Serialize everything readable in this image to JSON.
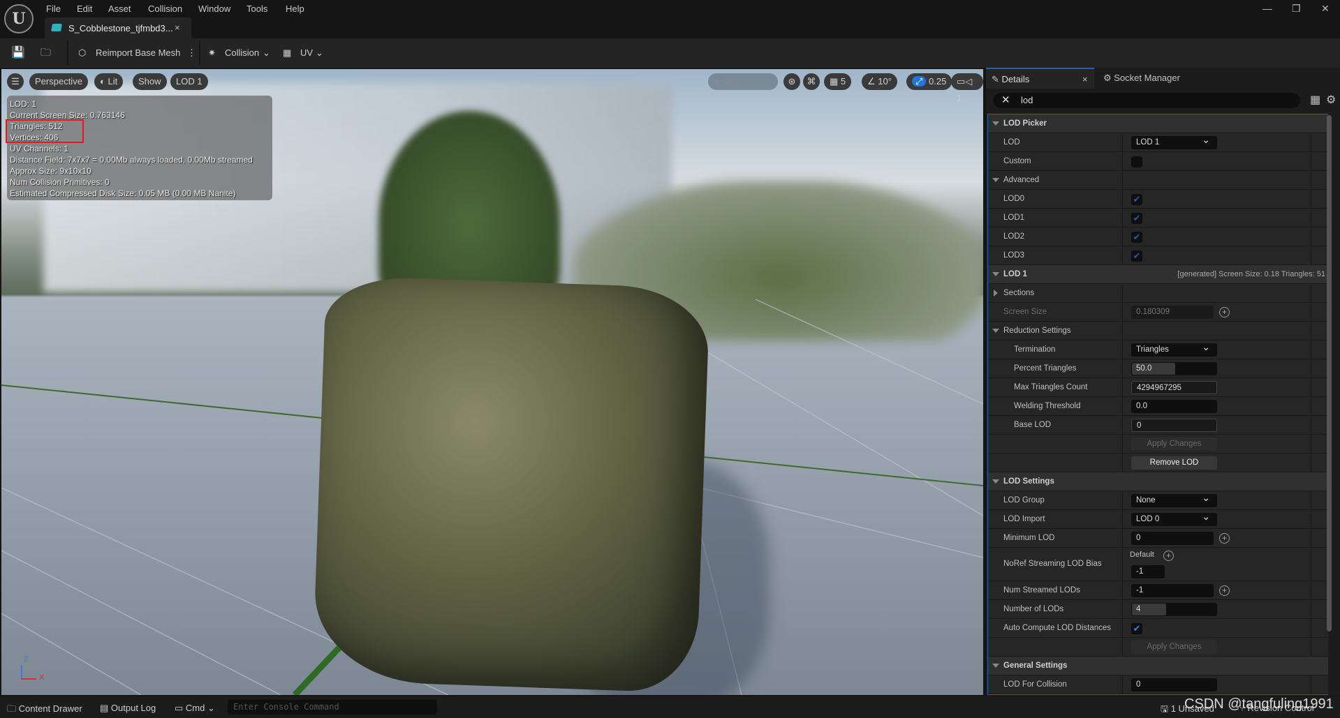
{
  "menu": [
    "File",
    "Edit",
    "Asset",
    "Collision",
    "Window",
    "Tools",
    "Help"
  ],
  "doc_tab": {
    "title": "S_Cobblestone_tjfmbd3...",
    "close": "×"
  },
  "toolbar": {
    "reimport": "Reimport Base Mesh",
    "collision": "Collision",
    "uv": "UV"
  },
  "viewport": {
    "buttons": [
      "Perspective",
      "Lit",
      "Show",
      "LOD 1"
    ],
    "right_tools": {
      "grid": "5",
      "angle": "10°",
      "scale": "0.25",
      "camera": "1"
    },
    "stats": [
      "LOD:  1",
      "Current Screen Size:  0.763146",
      "Triangles:  512",
      "Vertices:  406",
      "UV Channels:  1",
      "Distance Field:  7x7x7 = 0.00Mb always loaded, 0.00Mb streamed",
      "Approx Size: 9x10x10",
      "Num Collision Primitives:  0",
      "Estimated Compressed Disk Size: 0.05 MB (0.00 MB Nanite)"
    ],
    "axis": {
      "z": "Z",
      "x": "X"
    },
    "highlight_color": "#e21c1c"
  },
  "details": {
    "tab": "Details",
    "tab_close": "×",
    "socket_tab": "Socket Manager",
    "search": "lod",
    "accent": "#1f62b0",
    "rows": [
      {
        "t": "h",
        "label": "LOD Picker"
      },
      {
        "label": "LOD",
        "v": "dd",
        "value": "LOD 1"
      },
      {
        "label": "Custom",
        "v": "chk",
        "checked": false
      },
      {
        "t": "sub",
        "label": "Advanced"
      },
      {
        "label": "LOD0",
        "v": "chk",
        "checked": true
      },
      {
        "label": "LOD1",
        "v": "chk",
        "checked": true
      },
      {
        "label": "LOD2",
        "v": "chk",
        "checked": true
      },
      {
        "label": "LOD3",
        "v": "chk",
        "checked": true
      },
      {
        "t": "h",
        "label": "LOD 1",
        "extra": "[generated]   Screen Size: 0.18    Triangles: 51"
      },
      {
        "t": "subr",
        "label": "Sections"
      },
      {
        "label": "Screen Size",
        "v": "num",
        "value": "0.180309",
        "plus": true,
        "dim": true
      },
      {
        "t": "sub",
        "label": "Reduction Settings"
      },
      {
        "label": "Termination",
        "v": "dd",
        "value": "Triangles",
        "ind": true
      },
      {
        "label": "Percent Triangles",
        "v": "slider",
        "value": "50.0",
        "fill": 0.5,
        "ind": true
      },
      {
        "label": "Max Triangles Count",
        "v": "lt",
        "value": "4294967295",
        "ind": true
      },
      {
        "label": "Welding Threshold",
        "v": "num",
        "value": "0.0",
        "ind": true
      },
      {
        "label": "Base LOD",
        "v": "lt",
        "value": "0",
        "ind": true
      },
      {
        "label": "",
        "v": "btn",
        "value": "Apply Changes",
        "disabled": true,
        "ind": true
      },
      {
        "label": "",
        "v": "btn",
        "value": "Remove LOD"
      },
      {
        "t": "h",
        "label": "LOD Settings"
      },
      {
        "label": "LOD Group",
        "v": "dd",
        "value": "None"
      },
      {
        "label": "LOD Import",
        "v": "dd",
        "value": "LOD 0"
      },
      {
        "label": "Minimum LOD",
        "v": "num",
        "value": "0",
        "plus": true
      },
      {
        "label": "NoRef Streaming LOD Bias",
        "v": "bias",
        "default": "Default",
        "value": "-1"
      },
      {
        "label": "Num Streamed LODs",
        "v": "num",
        "value": "-1",
        "plus": true
      },
      {
        "label": "Number of LODs",
        "v": "slider",
        "value": "4",
        "fill": 0.4
      },
      {
        "label": "Auto Compute LOD Distances",
        "v": "chk",
        "checked": true,
        "bright": true
      },
      {
        "label": "",
        "v": "btn",
        "value": "Apply Changes",
        "disabled": true
      },
      {
        "t": "h",
        "label": "General Settings"
      },
      {
        "label": "LOD For Collision",
        "v": "num",
        "value": "0"
      }
    ]
  },
  "statusbar": {
    "content_drawer": "Content Drawer",
    "output_log": "Output Log",
    "cmd": "Cmd",
    "console_placeholder": "Enter Console Command",
    "unsaved": "1 Unsaved",
    "revision": "Revision Control",
    "watermark": "CSDN @tangfuling1991"
  }
}
